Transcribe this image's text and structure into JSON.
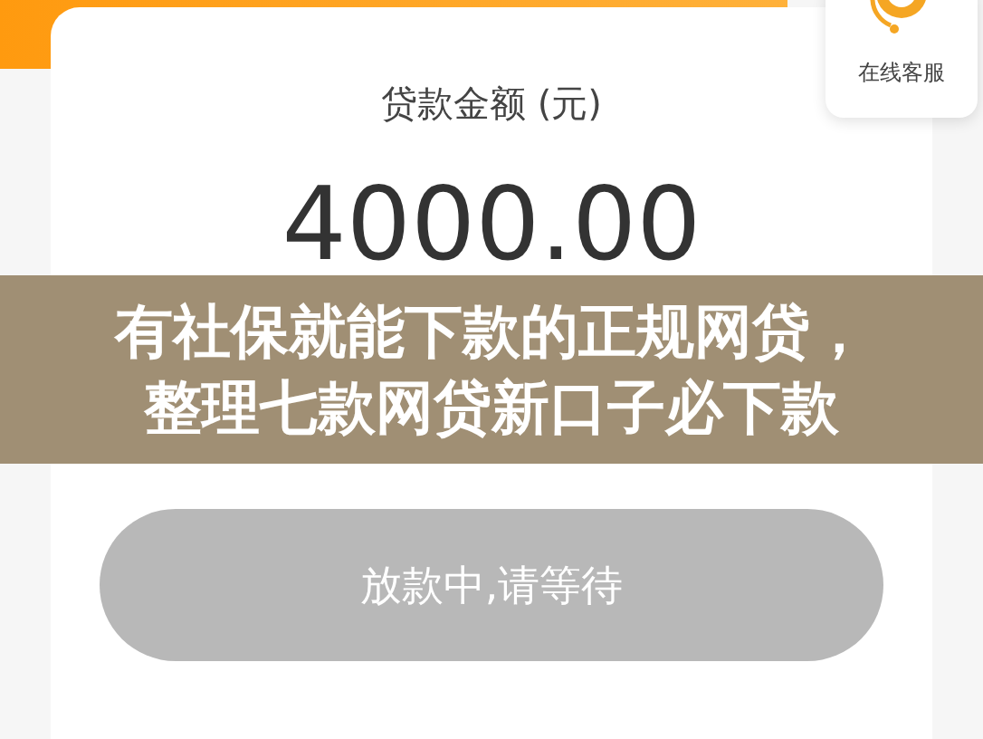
{
  "service_widget": {
    "label": "在线客服"
  },
  "loan": {
    "label": "贷款金额 (元)",
    "amount": "4000.00"
  },
  "status_button": {
    "label": "放款中,请等待",
    "disabled": true
  },
  "caption": {
    "lines": [
      "有社保就能下款的正规网贷，",
      "整理七款网贷新口子必下款"
    ]
  }
}
